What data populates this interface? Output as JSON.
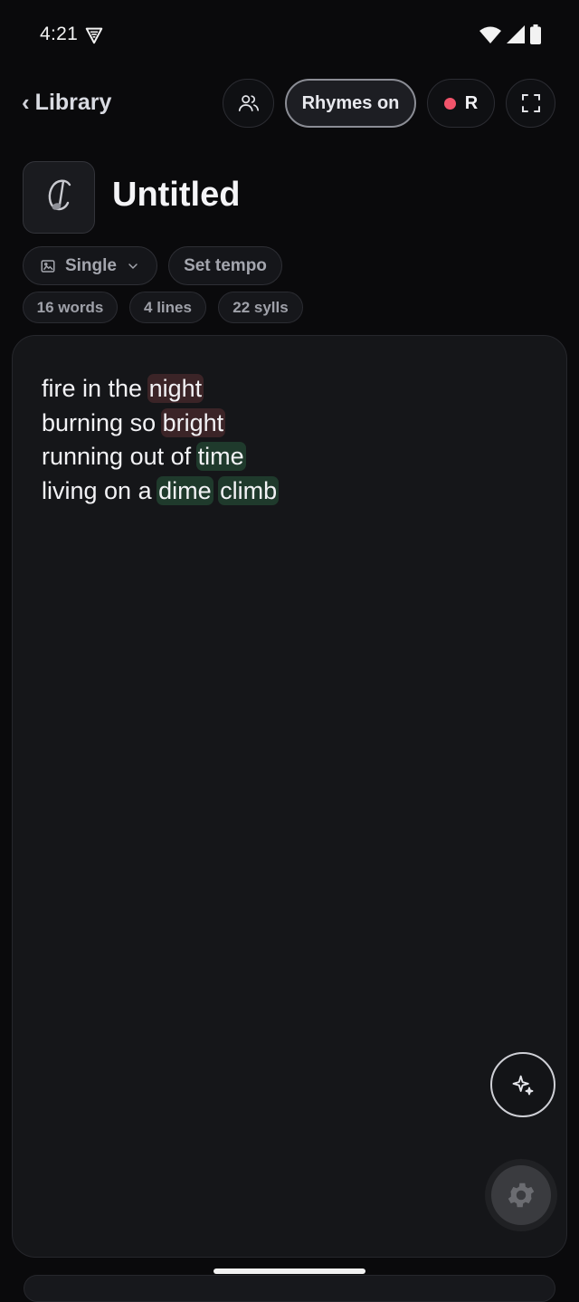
{
  "status_bar": {
    "time": "4:21"
  },
  "header": {
    "back_label": "Library",
    "rhymes_label": "Rhymes on",
    "record_label": "R"
  },
  "document": {
    "title": "Untitled",
    "mode_label": "Single",
    "tempo_label": "Set tempo",
    "stats": {
      "words": "16 words",
      "lines": "4 lines",
      "syllables": "22 sylls"
    }
  },
  "lyrics": {
    "lines": [
      {
        "plain": "fire in the ",
        "rhymes": [
          {
            "word": "night",
            "color": "red"
          }
        ]
      },
      {
        "plain": "burning so ",
        "rhymes": [
          {
            "word": "bright",
            "color": "red"
          }
        ]
      },
      {
        "plain": "running out of ",
        "rhymes": [
          {
            "word": "time",
            "color": "green"
          }
        ]
      },
      {
        "plain": "living on a ",
        "rhymes": [
          {
            "word": "dime",
            "color": "green"
          },
          {
            "word": "climb",
            "color": "green"
          }
        ]
      }
    ]
  },
  "colors": {
    "background": "#0a0a0c",
    "editor_background": "#151619",
    "rhyme_red": "#3b2427",
    "rhyme_green": "#1f3a2c",
    "record_dot": "#f2546b"
  },
  "icons": {
    "collab": "people-icon",
    "fullscreen": "fullscreen-icon",
    "logo": "music-note-logo",
    "mode": "image-icon",
    "ai": "sparkle-icon",
    "settings": "gear-icon"
  }
}
